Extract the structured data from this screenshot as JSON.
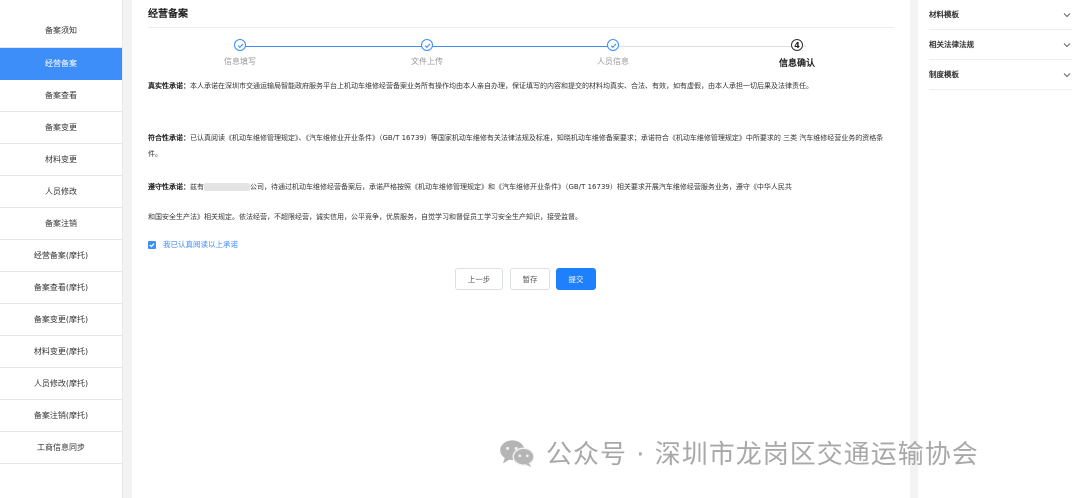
{
  "sidebar": {
    "items": [
      {
        "label": "备案须知"
      },
      {
        "label": "经营备案",
        "active": true
      },
      {
        "label": "备案查看"
      },
      {
        "label": "备案变更"
      },
      {
        "label": "材料变更"
      },
      {
        "label": "人员修改"
      },
      {
        "label": "备案注销"
      },
      {
        "label": "经营备案(摩托)"
      },
      {
        "label": "备案查看(摩托)"
      },
      {
        "label": "备案变更(摩托)"
      },
      {
        "label": "材料变更(摩托)"
      },
      {
        "label": "人员修改(摩托)"
      },
      {
        "label": "备案注销(摩托)"
      },
      {
        "label": "工商信息同步"
      }
    ]
  },
  "main": {
    "title": "经营备案",
    "steps": [
      {
        "label": "信息填写",
        "status": "done"
      },
      {
        "label": "文件上传",
        "status": "done"
      },
      {
        "label": "人员信息",
        "status": "done"
      },
      {
        "label": "信息确认",
        "status": "current",
        "number": "4"
      }
    ],
    "commitments": {
      "truth": {
        "title": "真实性承诺：",
        "text": "本人承诺在深圳市交通运输局智能政府服务平台上机动车维修经营备案业务所有操作均由本人亲自办理，保证填写的内容和提交的材料均真实、合法、有效，如有虚假，由本人承担一切后果及法律责任。"
      },
      "compliance": {
        "title": "符合性承诺：",
        "text": "已认真阅读《机动车维修管理规定》、《汽车维修业开业条件》（GB/T 16739）等国家机动车维修有关法律法规及标准，知晓机动车维修备案要求；承诺符合《机动车维修管理规定》中所要求的 三类 汽车维修经营业务的资格条件。"
      },
      "obey": {
        "title": "遵守性承诺：",
        "prefix": "兹有",
        "text_line1": "公司，待通过机动车维修经营备案后，承诺严格按照《机动车维修管理规定》和《汽车维修开业条件》（GB/T 16739）相关要求开展汽车维修经营服务业务，遵守《中华人民共",
        "text_line2": "和国安全生产法》相关规定。依法经营，不超限经营，诚实信用，公平竞争，优质服务，自觉学习和督促员工学习安全生产知识，接受监督。"
      }
    },
    "agree_label": "我已认真阅读以上承诺",
    "agree_checked": true,
    "buttons": {
      "prev": "上一步",
      "save": "暂存",
      "submit": "提交"
    }
  },
  "right_panel": {
    "items": [
      {
        "label": "材料模板"
      },
      {
        "label": "相关法律法规"
      },
      {
        "label": "制度模板"
      }
    ]
  },
  "watermark": {
    "text": "公众号 · 深圳市龙岗区交通运输协会"
  },
  "colors": {
    "accent": "#3d8ef8",
    "primary_button": "#1e80ff"
  }
}
